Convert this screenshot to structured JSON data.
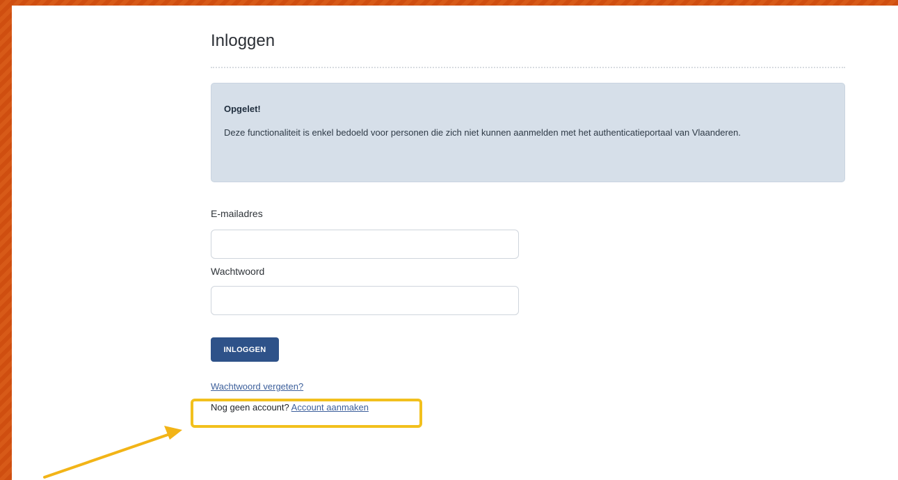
{
  "page": {
    "title": "Inloggen"
  },
  "alert": {
    "title": "Opgelet!",
    "text": "Deze functionaliteit is enkel bedoeld voor personen die zich niet kunnen aanmelden met het authenticatieportaal van Vlaanderen."
  },
  "form": {
    "email_label": "E-mailadres",
    "email_value": "",
    "password_label": "Wachtwoord",
    "password_value": "",
    "submit_label": "INLOGGEN"
  },
  "links": {
    "forgot_password": "Wachtwoord vergeten?",
    "no_account_text": "Nog geen account?",
    "create_account": "Account aanmaken"
  },
  "colors": {
    "background": "#d2500f",
    "alert_bg": "#d6dfe9",
    "button": "#2e5289",
    "link": "#3c5f9b",
    "highlight": "#f2c01d"
  }
}
